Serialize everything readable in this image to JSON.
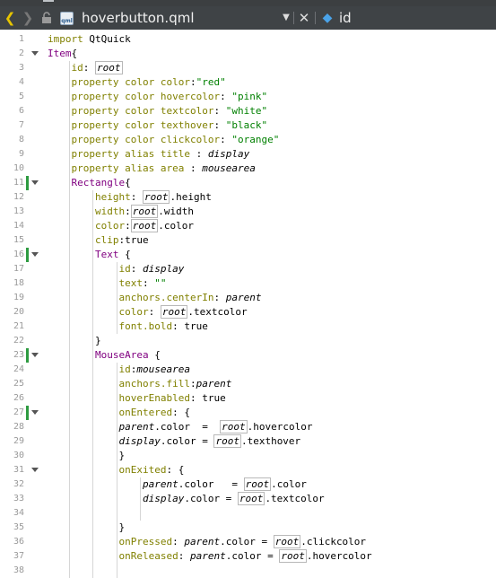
{
  "toolbar": {
    "file_name": "hoverbutton.qml",
    "file_type_badge": "qml",
    "symbol_name": "id",
    "icons": [
      "back-arrow-icon",
      "forward-arrow-icon",
      "lock-icon",
      "qml-file-icon",
      "chevron-down-icon",
      "close-icon",
      "symbol-icon"
    ]
  },
  "editor": {
    "lines": [
      {
        "n": "1",
        "t": [
          [
            "kw",
            "import"
          ],
          [
            "p",
            " QtQuick"
          ]
        ]
      },
      {
        "n": "2",
        "t": [
          [
            "ty",
            "Item"
          ],
          [
            "p",
            "{"
          ]
        ]
      },
      {
        "n": "3",
        "t": [
          [
            "p",
            "    "
          ],
          [
            "kw",
            "id"
          ],
          [
            "p",
            ": "
          ],
          [
            "ref",
            "root"
          ]
        ]
      },
      {
        "n": "4",
        "t": [
          [
            "p",
            "    "
          ],
          [
            "kw",
            "property"
          ],
          [
            "p",
            " "
          ],
          [
            "kw",
            "color"
          ],
          [
            "p",
            " "
          ],
          [
            "kw",
            "color"
          ],
          [
            "p",
            ":"
          ],
          [
            "str",
            "\"red\""
          ]
        ]
      },
      {
        "n": "5",
        "t": [
          [
            "p",
            "    "
          ],
          [
            "kw",
            "property"
          ],
          [
            "p",
            " "
          ],
          [
            "kw",
            "color"
          ],
          [
            "p",
            " "
          ],
          [
            "kw",
            "hovercolor"
          ],
          [
            "p",
            ": "
          ],
          [
            "str",
            "\"pink\""
          ]
        ]
      },
      {
        "n": "6",
        "t": [
          [
            "p",
            "    "
          ],
          [
            "kw",
            "property"
          ],
          [
            "p",
            " "
          ],
          [
            "kw",
            "color"
          ],
          [
            "p",
            " "
          ],
          [
            "kw",
            "textcolor"
          ],
          [
            "p",
            ": "
          ],
          [
            "str",
            "\"white\""
          ]
        ]
      },
      {
        "n": "7",
        "t": [
          [
            "p",
            "    "
          ],
          [
            "kw",
            "property"
          ],
          [
            "p",
            " "
          ],
          [
            "kw",
            "color"
          ],
          [
            "p",
            " "
          ],
          [
            "kw",
            "texthover"
          ],
          [
            "p",
            ": "
          ],
          [
            "str",
            "\"black\""
          ]
        ]
      },
      {
        "n": "8",
        "t": [
          [
            "p",
            "    "
          ],
          [
            "kw",
            "property"
          ],
          [
            "p",
            " "
          ],
          [
            "kw",
            "color"
          ],
          [
            "p",
            " "
          ],
          [
            "kw",
            "clickcolor"
          ],
          [
            "p",
            ": "
          ],
          [
            "str",
            "\"orange\""
          ]
        ]
      },
      {
        "n": "9",
        "t": [
          [
            "p",
            "    "
          ],
          [
            "kw",
            "property"
          ],
          [
            "p",
            " "
          ],
          [
            "kw",
            "alias"
          ],
          [
            "p",
            " "
          ],
          [
            "kw",
            "title"
          ],
          [
            "p",
            " : "
          ],
          [
            "ital",
            "display"
          ]
        ]
      },
      {
        "n": "10",
        "t": [
          [
            "p",
            "    "
          ],
          [
            "kw",
            "property"
          ],
          [
            "p",
            " "
          ],
          [
            "kw",
            "alias"
          ],
          [
            "p",
            " "
          ],
          [
            "kw",
            "area"
          ],
          [
            "p",
            " : "
          ],
          [
            "ital",
            "mousearea"
          ]
        ]
      },
      {
        "n": "11",
        "t": [
          [
            "p",
            "    "
          ],
          [
            "ty",
            "Rectangle"
          ],
          [
            "p",
            "{"
          ]
        ]
      },
      {
        "n": "12",
        "t": [
          [
            "p",
            "        "
          ],
          [
            "kw",
            "height"
          ],
          [
            "p",
            ": "
          ],
          [
            "ref",
            "root"
          ],
          [
            "p",
            ".height"
          ]
        ]
      },
      {
        "n": "13",
        "t": [
          [
            "p",
            "        "
          ],
          [
            "kw",
            "width"
          ],
          [
            "p",
            ":"
          ],
          [
            "ref",
            "root"
          ],
          [
            "p",
            ".width"
          ]
        ]
      },
      {
        "n": "14",
        "t": [
          [
            "p",
            "        "
          ],
          [
            "kw",
            "color"
          ],
          [
            "p",
            ":"
          ],
          [
            "ref",
            "root"
          ],
          [
            "p",
            ".color"
          ]
        ]
      },
      {
        "n": "15",
        "t": [
          [
            "p",
            "        "
          ],
          [
            "kw",
            "clip"
          ],
          [
            "p",
            ":true"
          ]
        ]
      },
      {
        "n": "16",
        "t": [
          [
            "p",
            "        "
          ],
          [
            "ty",
            "Text"
          ],
          [
            "p",
            " {"
          ]
        ]
      },
      {
        "n": "17",
        "t": [
          [
            "p",
            "            "
          ],
          [
            "kw",
            "id"
          ],
          [
            "p",
            ": "
          ],
          [
            "ital",
            "display"
          ]
        ]
      },
      {
        "n": "18",
        "t": [
          [
            "p",
            "            "
          ],
          [
            "kw",
            "text"
          ],
          [
            "p",
            ": "
          ],
          [
            "str",
            "\"\""
          ]
        ]
      },
      {
        "n": "19",
        "t": [
          [
            "p",
            "            "
          ],
          [
            "kw",
            "anchors.centerIn"
          ],
          [
            "p",
            ": "
          ],
          [
            "ital",
            "parent"
          ]
        ]
      },
      {
        "n": "20",
        "t": [
          [
            "p",
            "            "
          ],
          [
            "kw",
            "color"
          ],
          [
            "p",
            ": "
          ],
          [
            "ref",
            "root"
          ],
          [
            "p",
            ".textcolor"
          ]
        ]
      },
      {
        "n": "21",
        "t": [
          [
            "p",
            "            "
          ],
          [
            "kw",
            "font.bold"
          ],
          [
            "p",
            ": true"
          ]
        ]
      },
      {
        "n": "22",
        "t": [
          [
            "p",
            "        }"
          ]
        ]
      },
      {
        "n": "23",
        "t": [
          [
            "p",
            "        "
          ],
          [
            "ty",
            "MouseArea"
          ],
          [
            "p",
            " {"
          ]
        ]
      },
      {
        "n": "24",
        "t": [
          [
            "p",
            "            "
          ],
          [
            "kw",
            "id"
          ],
          [
            "p",
            ":"
          ],
          [
            "ital",
            "mousearea"
          ]
        ]
      },
      {
        "n": "25",
        "t": [
          [
            "p",
            "            "
          ],
          [
            "kw",
            "anchors.fill"
          ],
          [
            "p",
            ":"
          ],
          [
            "ital",
            "parent"
          ]
        ]
      },
      {
        "n": "26",
        "t": [
          [
            "p",
            "            "
          ],
          [
            "kw",
            "hoverEnabled"
          ],
          [
            "p",
            ": true"
          ]
        ]
      },
      {
        "n": "27",
        "t": [
          [
            "p",
            "            "
          ],
          [
            "kw",
            "onEntered"
          ],
          [
            "p",
            ": {"
          ]
        ]
      },
      {
        "n": "28",
        "t": [
          [
            "p",
            "            "
          ],
          [
            "ital",
            "parent"
          ],
          [
            "p",
            ".color  =  "
          ],
          [
            "ref",
            "root"
          ],
          [
            "p",
            ".hovercolor"
          ]
        ]
      },
      {
        "n": "29",
        "t": [
          [
            "p",
            "            "
          ],
          [
            "ital",
            "display"
          ],
          [
            "p",
            ".color = "
          ],
          [
            "ref",
            "root"
          ],
          [
            "p",
            ".texthover"
          ]
        ]
      },
      {
        "n": "30",
        "t": [
          [
            "p",
            "            }"
          ]
        ]
      },
      {
        "n": "31",
        "t": [
          [
            "p",
            "            "
          ],
          [
            "kw",
            "onExited"
          ],
          [
            "p",
            ": {"
          ]
        ]
      },
      {
        "n": "32",
        "t": [
          [
            "p",
            "                "
          ],
          [
            "ital",
            "parent"
          ],
          [
            "p",
            ".color   = "
          ],
          [
            "ref",
            "root"
          ],
          [
            "p",
            ".color"
          ]
        ]
      },
      {
        "n": "33",
        "t": [
          [
            "p",
            "                "
          ],
          [
            "ital",
            "display"
          ],
          [
            "p",
            ".color = "
          ],
          [
            "ref",
            "root"
          ],
          [
            "p",
            ".textcolor"
          ]
        ]
      },
      {
        "n": "34",
        "t": [
          [
            "p",
            ""
          ]
        ]
      },
      {
        "n": "35",
        "t": [
          [
            "p",
            "            }"
          ]
        ]
      },
      {
        "n": "36",
        "t": [
          [
            "p",
            "            "
          ],
          [
            "kw",
            "onPressed"
          ],
          [
            "p",
            ": "
          ],
          [
            "ital",
            "parent"
          ],
          [
            "p",
            ".color = "
          ],
          [
            "ref",
            "root"
          ],
          [
            "p",
            ".clickcolor"
          ]
        ]
      },
      {
        "n": "37",
        "t": [
          [
            "p",
            "            "
          ],
          [
            "kw",
            "onReleased"
          ],
          [
            "p",
            ": "
          ],
          [
            "ital",
            "parent"
          ],
          [
            "p",
            ".color = "
          ],
          [
            "ref",
            "root"
          ],
          [
            "p",
            ".hovercolor"
          ]
        ]
      },
      {
        "n": "38",
        "t": [
          [
            "p",
            ""
          ]
        ]
      }
    ]
  },
  "colors": {
    "keyword": "#808000",
    "type": "#800080",
    "string": "#008000",
    "toolbar_bg": "#3f4346",
    "fold_marker": "#2e9b41"
  }
}
